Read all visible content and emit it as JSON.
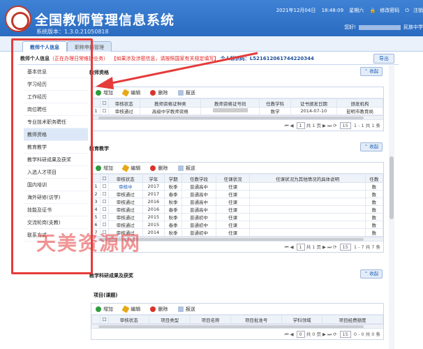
{
  "header": {
    "title": "全国教师管理信息系统",
    "version": "系统版本：1.3.0.21050818",
    "date": "2021年12月04日",
    "time": "18:48:09",
    "weekday": "星期六",
    "change_password": "修改密码",
    "logout": "注销",
    "greeting": "您好!",
    "school": "民族中学"
  },
  "tabs": [
    "教师个人信息",
    "职称申报管理"
  ],
  "infobar": {
    "label": "教师个人信息",
    "status": "（正在办理日常维护业务）",
    "warning": "【如果涉及涉密信息，请按照国家有关规定填写】",
    "id_label": "个人标识码：",
    "id": "L521612061744220344",
    "export": "导出"
  },
  "sidebar": [
    "基本信息",
    "学习经历",
    "工作经历",
    "岗位聘任",
    "专业技术职务聘任",
    "教师资格",
    "教育教学",
    "教学科研成果及获奖",
    "入选人才项目",
    "国内培训",
    "海外研修(访学)",
    "技能及证书",
    "交流轮岗(支教)",
    "联系方式"
  ],
  "toolbar": {
    "add": "增加",
    "edit": "编辑",
    "delete": "删除",
    "report": "报送"
  },
  "collapse_label": "收起",
  "section1": {
    "title": "教师资格",
    "columns": [
      "审核状态",
      "教师资格证种类",
      "教师资格证号码",
      "任教学科",
      "证书颁发日期",
      "颁发机构"
    ],
    "rows": [
      [
        "1",
        "审核通过",
        "高级中学教师资格",
        "",
        "数学",
        "2014-07-10",
        "昆明市教育局"
      ]
    ],
    "pager": {
      "page": "1",
      "of": "共 1 页",
      "size": "15",
      "range": "1 - 1",
      "total": "共 1 条"
    }
  },
  "section2": {
    "title": "教育教学",
    "columns": [
      "审核状态",
      "学年",
      "学期",
      "任教学段",
      "任课状况",
      "任课状况为其他情况的具体说明",
      "任教"
    ],
    "rows": [
      [
        "1",
        "审核中",
        "2017",
        "秋季",
        "普通高中",
        "任课",
        "数"
      ],
      [
        "2",
        "审核通过",
        "2017",
        "春季",
        "普通高中",
        "任课",
        "数"
      ],
      [
        "3",
        "审核通过",
        "2016",
        "秋季",
        "普通高中",
        "任课",
        "数"
      ],
      [
        "4",
        "审核通过",
        "2016",
        "春季",
        "普通高中",
        "任课",
        "数"
      ],
      [
        "5",
        "审核通过",
        "2015",
        "秋季",
        "普通初中",
        "任课",
        "数"
      ],
      [
        "6",
        "审核通过",
        "2015",
        "春季",
        "普通初中",
        "任课",
        "数"
      ],
      [
        "7",
        "审核通过",
        "2014",
        "秋季",
        "普通初中",
        "任课",
        "数"
      ]
    ],
    "pager": {
      "page": "1",
      "of": "共 1 页",
      "size": "15",
      "range": "1 - 7",
      "total": "共 7 条"
    }
  },
  "section3": {
    "title": "教学科研成果及获奖",
    "subtitle": "项目(课题)",
    "columns": [
      "审核状态",
      "项目类型",
      "项目名称",
      "项目批准号",
      "学科领域",
      "项目经费额度"
    ],
    "pager": {
      "page": "0",
      "of": "共 0 页",
      "size": "15",
      "range": "0 - 0",
      "total": "共 0 条"
    }
  },
  "watermark": "天美资源网"
}
